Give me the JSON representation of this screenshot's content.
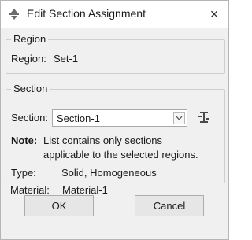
{
  "window": {
    "title": "Edit Section Assignment",
    "icon": "section-assign-icon",
    "close_symbol": "×"
  },
  "region_group": {
    "legend": "Region",
    "label": "Region:",
    "value": "Set-1"
  },
  "section_group": {
    "legend": "Section",
    "section_label": "Section:",
    "section_value": "Section-1",
    "note_label": "Note:",
    "note_line1": "List contains only sections",
    "note_line2": "applicable to the selected regions.",
    "type_label": "Type:",
    "type_value": "Solid, Homogeneous",
    "material_label": "Material:",
    "material_value": "Material-1"
  },
  "buttons": {
    "ok": "OK",
    "cancel": "Cancel"
  },
  "colors": {
    "title_background": "#ffffff",
    "dialog_background": "#f0f0f0",
    "button_background": "#e6e6e6",
    "border": "#b5b5b5"
  }
}
